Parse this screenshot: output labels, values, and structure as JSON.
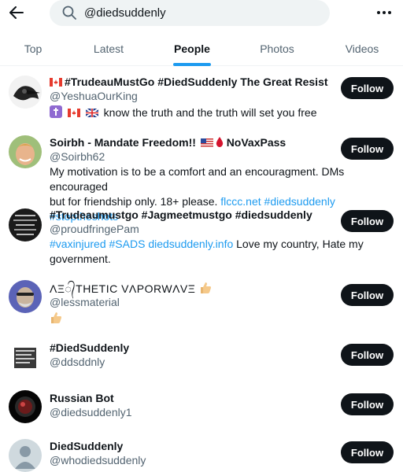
{
  "search": {
    "query": "@diedsuddenly"
  },
  "tabs": [
    {
      "label": "Top"
    },
    {
      "label": "Latest"
    },
    {
      "label": "People",
      "active": true
    },
    {
      "label": "Photos"
    },
    {
      "label": "Videos"
    }
  ],
  "follow_label": "Follow",
  "users": [
    {
      "name": "#TrudeauMustGo #DiedSuddenly The Great Resist",
      "handle": "@YeshuaOurKing",
      "bio": "know the truth and the truth will set you free"
    },
    {
      "name_a": "Soirbh - Mandate Freedom!!",
      "name_b": "NoVaxPass",
      "handle": "@Soirbh62",
      "bio_line1": "My motivation is to be a comfort and an encouragment. DMs encouraged",
      "bio_line2_text": "but for friendship only. 18+ please.",
      "bio_link1": "flccc.net",
      "bio_link2": "#diedsuddenly",
      "bio_link3": "#stoptheshots"
    },
    {
      "name": "#Trudeaumustgo #Jagmeetmustgo #diedsuddenly",
      "handle": "@proudfringePam",
      "bio_link1": "#vaxinjured",
      "bio_link2": "#SADS",
      "bio_link3": "diedsuddenly.info",
      "bio_text": "Love my country, Hate my",
      "bio_line2": "government."
    },
    {
      "name": "ΛΞ᭄THETIC VΛPORWΛVΞ",
      "handle": "@lessmaterial"
    },
    {
      "name": "#DiedSuddenly",
      "handle": "@ddsddnly"
    },
    {
      "name": "Russian Bot",
      "handle": "@diedsuddenly1"
    },
    {
      "name": "DiedSuddenly",
      "handle": "@whodiedsuddenly"
    }
  ]
}
